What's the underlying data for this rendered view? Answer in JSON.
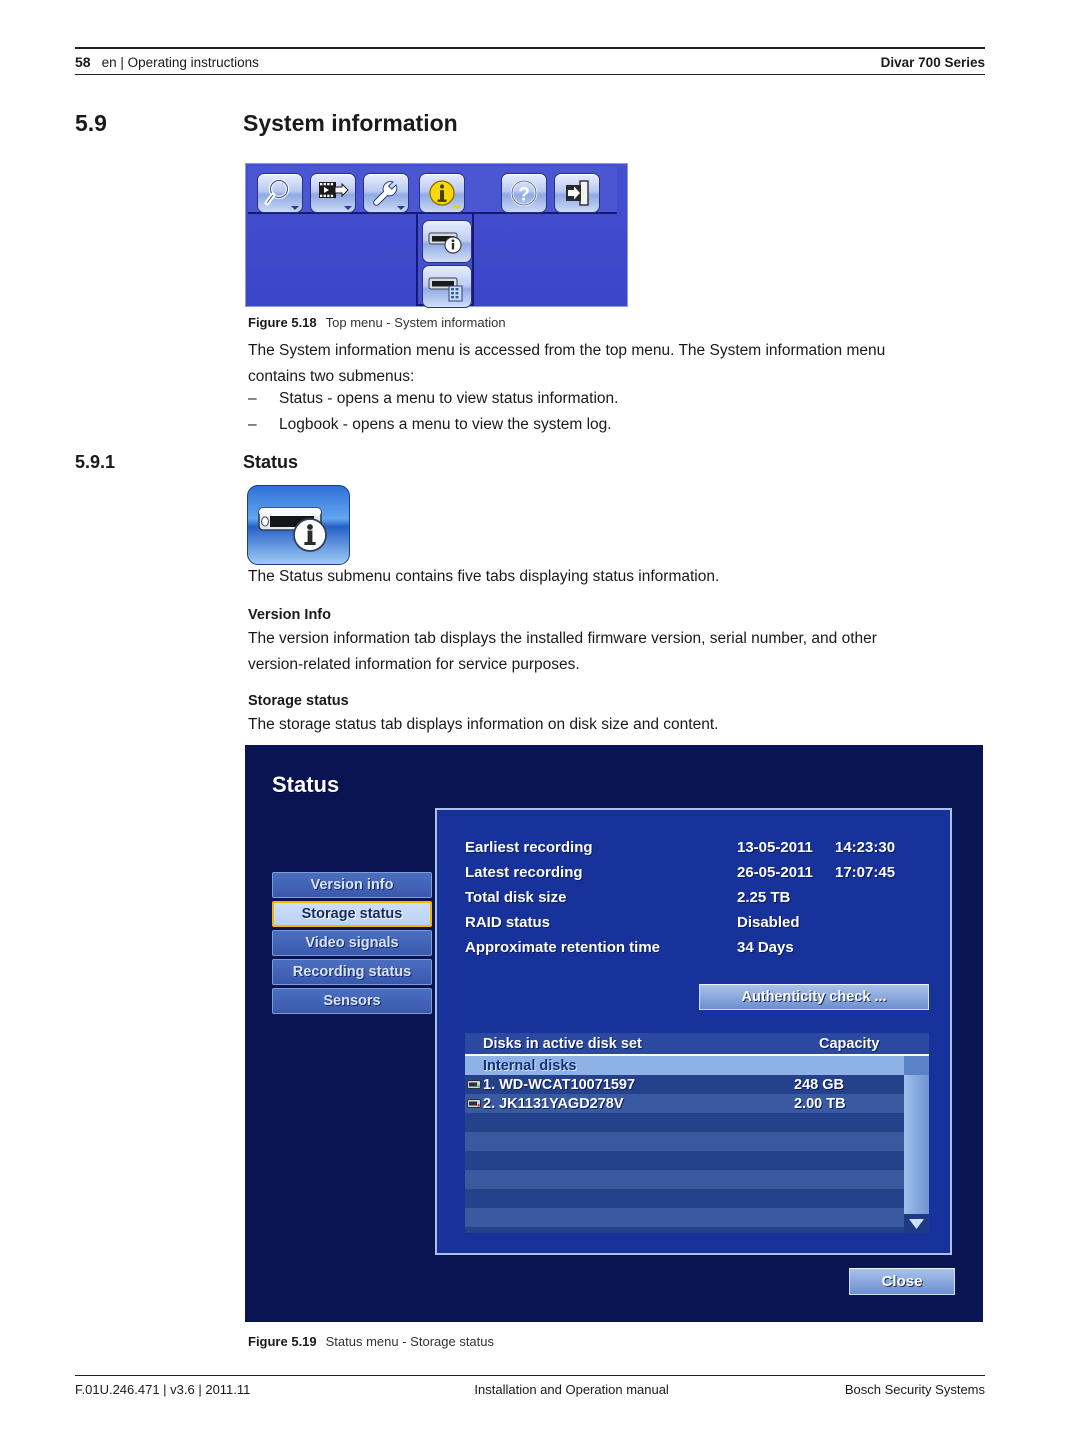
{
  "header": {
    "page_number": "58",
    "breadcrumb": "en | Operating instructions",
    "product": "Divar 700 Series"
  },
  "section": {
    "number": "5.9",
    "title": "System information",
    "sub_number": "5.9.1",
    "sub_title": "Status"
  },
  "figures": {
    "fig18": {
      "label": "Figure  5.18",
      "text": "Top menu - System information",
      "top_menu_icons": [
        "search-icon",
        "playback-film-icon",
        "wrench-configuration-icon",
        "system-information-info-icon",
        "help-question-icon",
        "exit-door-icon"
      ],
      "submenu_icons": [
        "status-device-info-icon",
        "logbook-device-list-icon"
      ]
    },
    "fig19": {
      "label": "Figure  5.19",
      "text": "Status menu - Storage status"
    }
  },
  "paragraphs": {
    "intro_line1": "The System information menu is accessed from the top menu. The System information menu",
    "intro_line2": "contains two submenus:",
    "bullets": [
      {
        "dash": "–",
        "text": "Status - opens a menu to view status information."
      },
      {
        "dash": "–",
        "text": "Logbook - opens a menu to view the system log."
      }
    ],
    "status_intro": "The Status submenu contains five tabs displaying status information.",
    "version_info_head": "Version Info",
    "version_info_line1": "The version information tab displays the installed firmware version, serial number, and other",
    "version_info_line2": "version-related information for service purposes.",
    "storage_status_head": "Storage status",
    "storage_status_body": "The storage status tab displays information on disk size and content."
  },
  "osd": {
    "title": "Status",
    "tabs": [
      {
        "label": "Version info",
        "selected": false
      },
      {
        "label": "Storage status",
        "selected": true
      },
      {
        "label": "Video signals",
        "selected": false
      },
      {
        "label": "Recording status",
        "selected": false
      },
      {
        "label": "Sensors",
        "selected": false
      }
    ],
    "info_rows": [
      {
        "label": "Earliest recording",
        "value1": "13-05-2011",
        "value2": "14:23:30"
      },
      {
        "label": "Latest recording",
        "value1": "26-05-2011",
        "value2": "17:07:45"
      },
      {
        "label": "Total disk size",
        "value1": "2.25 TB",
        "value2": ""
      },
      {
        "label": "RAID status",
        "value1": "Disabled",
        "value2": ""
      },
      {
        "label": "Approximate retention time",
        "value1": "34  Days",
        "value2": ""
      }
    ],
    "authenticity_button": "Authenticity check ...",
    "table": {
      "columns": [
        "Disks in active disk set",
        "Capacity"
      ],
      "group_row": "Internal disks",
      "rows": [
        {
          "name": "1. WD-WCAT10071597",
          "capacity": "248 GB",
          "led": "#39d14a"
        },
        {
          "name": "2. JK1131YAGD278V",
          "capacity": "2.00 TB",
          "led": "#e03a3a"
        }
      ],
      "empty_row_count": 8
    },
    "close_button": "Close",
    "colors": {
      "window_background": "#0b1452",
      "panel_background": "#17339b",
      "panel_border": "#a9c2e8",
      "tab_selected_border": "#f2b700",
      "tab_selected_background": "#cfe0f8",
      "row_odd": "#24428c",
      "row_even": "#3a5aa0",
      "group_row": "#8fb2e6"
    }
  },
  "footer": {
    "left": "F.01U.246.471 | v3.6 | 2011.11",
    "center": "Installation and Operation manual",
    "right": "Bosch Security Systems"
  }
}
